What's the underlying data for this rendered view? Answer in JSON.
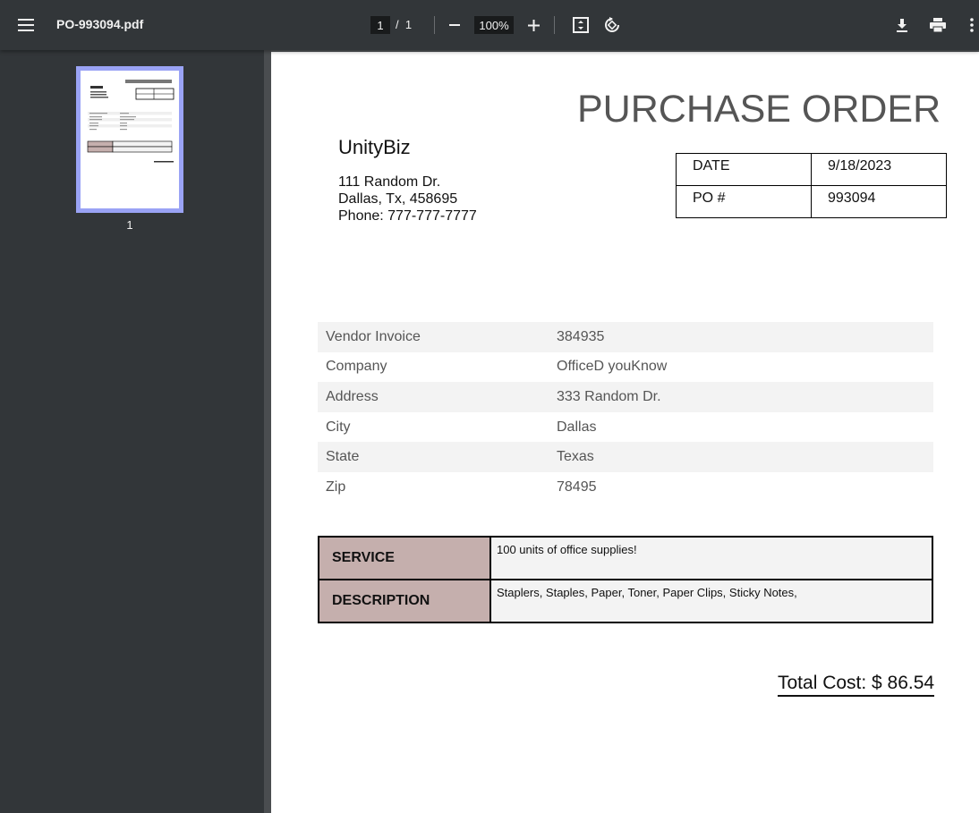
{
  "toolbar": {
    "filename": "PO-993094.pdf",
    "current_page": "1",
    "page_separator": "/",
    "total_pages": "1",
    "zoom": "100%"
  },
  "sidebar": {
    "thumbnails": [
      {
        "label": "1"
      }
    ]
  },
  "document": {
    "title": "PURCHASE ORDER",
    "company": "UnityBiz",
    "address_lines": [
      "111 Random Dr.",
      "Dallas, Tx, 458695",
      "Phone: 777-777-7777"
    ],
    "meta": [
      {
        "label": "DATE",
        "value": "9/18/2023"
      },
      {
        "label": "PO #",
        "value": "993094"
      }
    ],
    "vendor_rows": [
      {
        "label": "Vendor Invoice",
        "value": "384935"
      },
      {
        "label": "Company",
        "value": "OfficeD youKnow"
      },
      {
        "label": "Address",
        "value": "333 Random Dr."
      },
      {
        "label": "City",
        "value": "Dallas"
      },
      {
        "label": "State",
        "value": "Texas"
      },
      {
        "label": "Zip",
        "value": "78495"
      }
    ],
    "service": {
      "label": "SERVICE",
      "value": "100 units of office supplies!"
    },
    "description": {
      "label": "DESCRIPTION",
      "value": "Staplers, Staples, Paper, Toner, Paper Clips, Sticky Notes,"
    },
    "total": "Total Cost: $ 86.54"
  },
  "icons": {
    "menu": "hamburger-icon",
    "zoom_out": "minus-icon",
    "zoom_in": "plus-icon",
    "fit": "fit-page-icon",
    "rotate": "rotate-icon",
    "download": "download-icon",
    "print": "print-icon",
    "more": "more-vert-icon"
  },
  "colors": {
    "toolbar_bg": "#323639",
    "viewer_bg": "#525659",
    "label_cell": "#c5afad",
    "thumb_highlight": "#9aa3f5"
  }
}
